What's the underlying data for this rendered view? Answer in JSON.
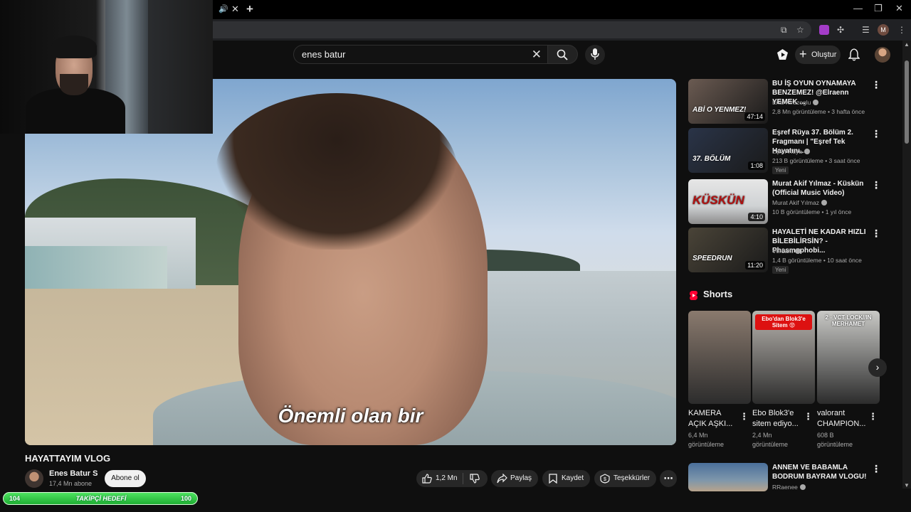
{
  "browser": {
    "window_controls": [
      "—",
      "❐",
      "✕"
    ],
    "profile_initial": "M"
  },
  "search": {
    "query": "enes batur"
  },
  "header": {
    "create_label": "Oluştur"
  },
  "video": {
    "caption": "Önemli olan bir",
    "title": "HAYATTAYIM VLOG",
    "channel": "Enes Batur S",
    "subscribers": "17,4 Mn abone",
    "subscribe_label": "Abone ol",
    "likes": "1,2 Mn",
    "share_label": "Paylaş",
    "save_label": "Kaydet",
    "thanks_label": "Teşekkürler"
  },
  "xp_bar": {
    "left": "104",
    "center": "TAKİPÇİ HEDEFİ",
    "right": "100",
    "progress": 1.0
  },
  "recommendations": [
    {
      "title": "BU İŞ OYUN OYNAMAYA BENZEMEZ! @Elraenn YEMEK ...",
      "channel": "Enis Kirazoglu",
      "meta": "2,8 Mn görüntüleme • 3 hafta önce",
      "duration": "47:14",
      "badge": "",
      "thumb_text": "ABİ O YENMEZ!",
      "thumb_color": "#6b5b52"
    },
    {
      "title": "Eşref Rüya 37. Bölüm 2. Fragmanı | \"Eşref Tek Hayatını...",
      "channel": "Eşref Rüya",
      "meta": "213 B görüntüleme • 3 saat önce",
      "duration": "1:08",
      "badge": "Yeni",
      "thumb_text": "37. BÖLÜM",
      "thumb_color": "#2a3448"
    },
    {
      "title": "Murat Akif Yılmaz - Küskün (Official Music Video)",
      "channel": "Murat Akif Yılmaz",
      "meta": "10 B görüntüleme • 1 yıl önce",
      "duration": "4:10",
      "badge": "",
      "thumb_text": "KÜSKÜN",
      "thumb_color": "#cfd2d4"
    },
    {
      "title": "HAYALETİ NE KADAR HIZLI BİLEBİLİRSİN? - Phasmophobi...",
      "channel": "Verdant",
      "meta": "1,4 B görüntüleme • 10 saat önce",
      "duration": "11:20",
      "badge": "Yeni",
      "thumb_text": "SPEEDRUN",
      "thumb_color": "#4a4438"
    }
  ],
  "shorts": {
    "heading": "Shorts",
    "items": [
      {
        "title": "KAMERA AÇIK AŞKI...",
        "views": "6,4 Mn görüntüleme",
        "thumb_text": "",
        "thumb_color": "#8a7a6e"
      },
      {
        "title": "Ebo Blok3'e sitem ediyo...",
        "views": "2,4 Mn görüntüleme",
        "thumb_text": "Ebo'dan Blok3'e Sitem 😡",
        "thumb_color": "#b8b4ae"
      },
      {
        "title": "valorant CHAMPION...",
        "views": "608 B görüntüleme",
        "thumb_text": "2 - VCT LOCK//IN MERHAMET",
        "thumb_color": "#c9c9c6"
      }
    ]
  },
  "next_rec": {
    "title": "ANNEM VE BABAMLA BODRUM BAYRAM VLOGU!",
    "channel": "RRaenee"
  },
  "colors": {
    "background": "#0f0f0f",
    "chip": "#272727",
    "xp_green": "#2cc443",
    "shorts_red": "#ff0033"
  }
}
